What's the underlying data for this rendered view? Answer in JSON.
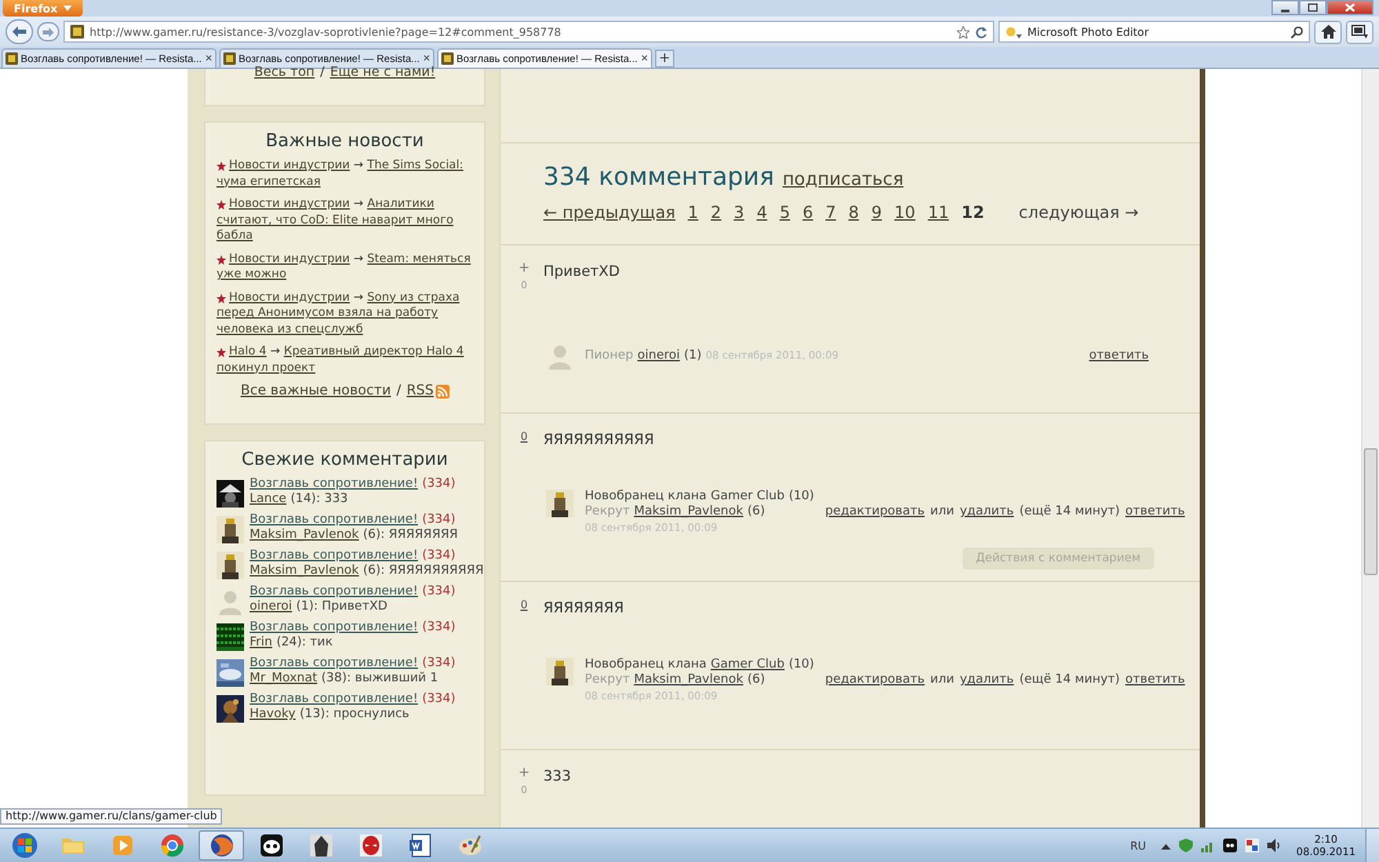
{
  "browser": {
    "menu_button": "Firefox",
    "url": "http://www.gamer.ru/resistance-3/vozglav-soprotivlenie?page=12#comment_958778",
    "search": "Microsoft Photo Editor",
    "tabs": [
      {
        "title": "Возглавь сопротивление! — Resista...",
        "close": "×",
        "selected": false
      },
      {
        "title": "Возглавь сопротивление! — Resista...",
        "close": "×",
        "selected": false
      },
      {
        "title": "Возглавь сопротивление! — Resista...",
        "close": "×",
        "selected": true
      }
    ],
    "new_tab": "+"
  },
  "sidebar": {
    "top_box": {
      "links": [
        "Весь топ",
        "Еще не с нами!"
      ],
      "separator": "/"
    },
    "news": {
      "title": "Важные новости",
      "items": [
        {
          "category": "Новости индустрии",
          "arrow": "→",
          "title": "The Sims Social: чума египетская"
        },
        {
          "category": "Новости индустрии",
          "arrow": "→",
          "title": "Аналитики считают, что CoD: Elite наварит много бабла"
        },
        {
          "category": "Новости индустрии",
          "arrow": "→",
          "title": "Steam: меняться уже можно"
        },
        {
          "category": "Новости индустрии",
          "arrow": "→",
          "title": "Sony из страха перед Анонимусом взяла на работу человека из спецслужб"
        },
        {
          "category": "Halo 4",
          "arrow": "→",
          "title": "Креативный директор Halo 4 покинул проект"
        }
      ],
      "all_link": "Все важные новости",
      "separator": "/",
      "rss": "RSS"
    },
    "fresh": {
      "title": "Свежие комментарии",
      "items": [
        {
          "post": "Возглавь сопротивление!",
          "count": "(334)",
          "user": "Lance",
          "meta": "(14): 333"
        },
        {
          "post": "Возглавь сопротивление!",
          "count": "(334)",
          "user": "Maksim_Pavlenok",
          "meta": "(6): ЯЯЯЯЯЯЯЯ"
        },
        {
          "post": "Возглавь сопротивление!",
          "count": "(334)",
          "user": "Maksim_Pavlenok",
          "meta": "(6): ЯЯЯЯЯЯЯЯЯЯЯ"
        },
        {
          "post": "Возглавь сопротивление!",
          "count": "(334)",
          "user": "oineroi",
          "meta": "(1): ПриветXD",
          "avatar": {
            "kind": "silhouette"
          }
        },
        {
          "post": "Возглавь сопротивление!",
          "count": "(334)",
          "user": "Frin",
          "meta": "(24): тик"
        },
        {
          "post": "Возглавь сопротивление!",
          "count": "(334)",
          "user": "Mr_Moxnat",
          "meta": "(38): выживший 1"
        },
        {
          "post": "Возглавь сопротивление!",
          "count": "(334)",
          "user": "Havoky",
          "meta": "(13): проснулись"
        }
      ]
    }
  },
  "comments_header": {
    "title": "334 комментария",
    "subscribe": "подписаться",
    "prev": "← предыдущая",
    "next": "следующая →",
    "pages": [
      {
        "label": "1",
        "selected": false
      },
      {
        "label": "2",
        "selected": false
      },
      {
        "label": "3",
        "selected": false
      },
      {
        "label": "4",
        "selected": false
      },
      {
        "label": "5",
        "selected": false
      },
      {
        "label": "6",
        "selected": false
      },
      {
        "label": "7",
        "selected": false
      },
      {
        "label": "8",
        "selected": false
      },
      {
        "label": "9",
        "selected": false
      },
      {
        "label": "10",
        "selected": false
      },
      {
        "label": "11",
        "selected": false
      },
      {
        "label": "12",
        "selected": true
      }
    ]
  },
  "comments": [
    {
      "plus": "+",
      "score": "0",
      "text": "ПриветXD",
      "avatar": {
        "kind": "silhouette"
      },
      "rank": "Пионер",
      "name": "oineroi",
      "count": "(1)",
      "date": "08 сентября 2011, 00:09",
      "actions": [
        {
          "kind": "link",
          "text": "ответить"
        }
      ]
    },
    {
      "score": "0",
      "text": "ЯЯЯЯЯЯЯЯЯЯЯ",
      "clan_prefix": "Новобранец клана",
      "clan": "Gamer Club",
      "clan_count": "(10)",
      "clan_hovered": false,
      "rank": "Рекрут",
      "name": "Maksim_Pavlenok",
      "count": "(6)",
      "date": "08 сентября 2011, 00:09",
      "actions": [
        {
          "kind": "link",
          "text": "редактировать"
        },
        {
          "kind": "text",
          "text": "или"
        },
        {
          "kind": "link",
          "text": "удалить"
        },
        {
          "kind": "text",
          "text": "(ещё 14 минут)"
        },
        {
          "kind": "link",
          "text": "ответить"
        }
      ],
      "menu_button": "Действия с комментарием"
    },
    {
      "score": "0",
      "text": "ЯЯЯЯЯЯЯЯ",
      "clan_prefix": "Новобранец клана",
      "clan": "Gamer Club",
      "clan_count": "(10)",
      "clan_hovered": true,
      "rank": "Рекрут",
      "name": "Maksim_Pavlenok",
      "count": "(6)",
      "date": "08 сентября 2011, 00:09",
      "actions": [
        {
          "kind": "link",
          "text": "редактировать"
        },
        {
          "kind": "text",
          "text": "или"
        },
        {
          "kind": "link",
          "text": "удалить"
        },
        {
          "kind": "text",
          "text": "(ещё 14 минут)"
        },
        {
          "kind": "link",
          "text": "ответить"
        }
      ]
    },
    {
      "plus": "+",
      "score": "0",
      "text": "333"
    }
  ],
  "status_url": "http://www.gamer.ru/clans/gamer-club",
  "taskbar": {
    "apps": [
      {
        "kind": "folder",
        "selected": false
      },
      {
        "kind": "media",
        "selected": false
      },
      {
        "kind": "ball",
        "selected": false
      },
      {
        "kind": "globe",
        "selected": true
      },
      {
        "kind": "panda",
        "selected": false
      },
      {
        "kind": "hood",
        "selected": false
      },
      {
        "kind": "mask",
        "selected": false
      },
      {
        "kind": "document",
        "selected": false
      },
      {
        "kind": "palette",
        "selected": false
      }
    ],
    "language": "RU",
    "time": "2:10",
    "date": "08.09.2011"
  }
}
